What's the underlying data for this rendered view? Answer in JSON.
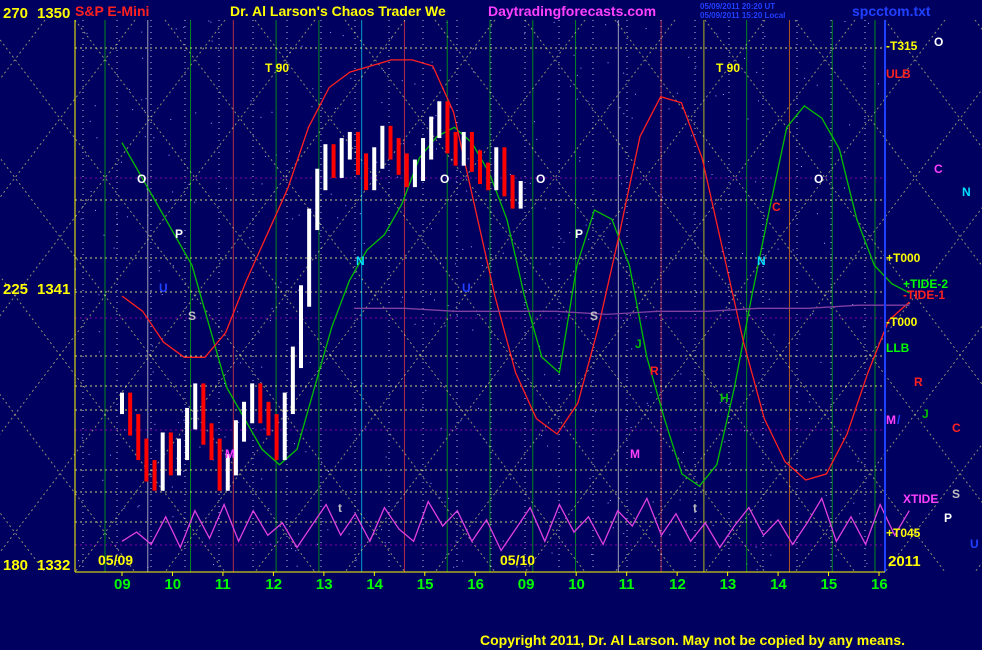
{
  "header": {
    "left_scale": "270",
    "price_top": "1350",
    "symbol": "S&P E-Mini",
    "title": "Dr. Al Larson's Chaos Trader We",
    "site": "Daytradingforecasts.com",
    "timestamp_ut": "05/09/2011 20:20 UT",
    "timestamp_local": "05/09/2011 15:20 Local",
    "file": "spcctom.txt"
  },
  "left_axis": {
    "mid_scale": "225",
    "price_mid": "1341",
    "bottom_scale": "180",
    "price_bottom": "1332"
  },
  "date_labels": [
    "05/09",
    "05/10"
  ],
  "year_label": "2011",
  "copyright": "Copyright 2011, Dr. Al Larson. May not be copied by any means.",
  "colors": {
    "background": "#000060",
    "price_up": "#ffffff",
    "price_down": "#ff0000",
    "grid_lines": "#ffff80",
    "green_line": "#00c000",
    "red_line": "#ff2020",
    "magenta_line": "#e040e0",
    "axis_text": "#ffff00",
    "title_text": "#ffff00",
    "site_text": "#ff40ff",
    "file_text": "#4060ff"
  },
  "chart_data": {
    "type": "line",
    "title": "S&P E-Mini",
    "x_ticks": [
      "09",
      "10",
      "11",
      "12",
      "13",
      "14",
      "15",
      "16",
      "09",
      "10",
      "11",
      "12",
      "13",
      "14",
      "15",
      "16"
    ],
    "y_ticks": [
      1350,
      1341,
      1332
    ],
    "ylim": [
      1332,
      1350
    ],
    "right_labels": [
      {
        "text": "-T315",
        "color": "#ffff00"
      },
      {
        "text": "ULB",
        "color": "#ff2020"
      },
      {
        "text": "+T000",
        "color": "#ffff00"
      },
      {
        "text": "+TIDE-2",
        "color": "#00ff00"
      },
      {
        "text": "-TIDE-1",
        "color": "#ff2020"
      },
      {
        "text": "-T000",
        "color": "#ffff00"
      },
      {
        "text": "LLB",
        "color": "#00ff00"
      },
      {
        "text": "M",
        "color": "#ff40ff"
      },
      {
        "text": "XTIDE",
        "color": "#ff40ff"
      },
      {
        "text": "+T045",
        "color": "#ffff00"
      }
    ],
    "planet_labels": [
      {
        "text": "O",
        "color": "#ffffff"
      },
      {
        "text": "C",
        "color": "#ff40ff"
      },
      {
        "text": "N",
        "color": "#00e0ff"
      },
      {
        "text": "C",
        "color": "#ff2020"
      },
      {
        "text": "R",
        "color": "#ff2020"
      },
      {
        "text": "J",
        "color": "#00c000"
      },
      {
        "text": "S",
        "color": "#c0c0c0"
      },
      {
        "text": "P",
        "color": "#ffffff"
      },
      {
        "text": "U",
        "color": "#2040ff"
      },
      {
        "text": "/",
        "color": "#2040ff"
      }
    ],
    "chart_markers": [
      {
        "text": "T  90",
        "color": "#ffff00"
      },
      {
        "text": "T  90",
        "color": "#ffff00"
      },
      {
        "text": "O",
        "color": "#ffffff"
      },
      {
        "text": "O",
        "color": "#ffffff"
      },
      {
        "text": "O",
        "color": "#ffffff"
      },
      {
        "text": "O",
        "color": "#ffffff"
      },
      {
        "text": "P",
        "color": "#ffffff"
      },
      {
        "text": "P",
        "color": "#ffffff"
      },
      {
        "text": "S",
        "color": "#c0c0c0"
      },
      {
        "text": "S",
        "color": "#c0c0c0"
      },
      {
        "text": "N",
        "color": "#00e0ff"
      },
      {
        "text": "N",
        "color": "#00e0ff"
      },
      {
        "text": "M",
        "color": "#ff40ff"
      },
      {
        "text": "M",
        "color": "#ff40ff"
      },
      {
        "text": "J",
        "color": "#00c000"
      },
      {
        "text": "H",
        "color": "#00c000"
      },
      {
        "text": "R",
        "color": "#ff2020"
      },
      {
        "text": "C",
        "color": "#ff2020"
      },
      {
        "text": "t",
        "color": "#c0c0c0"
      },
      {
        "text": "t",
        "color": "#c0c0c0"
      },
      {
        "text": "U",
        "color": "#2040ff"
      },
      {
        "text": "U",
        "color": "#2040ff"
      }
    ],
    "series": [
      {
        "type": "candles",
        "color_up": "#ffffff",
        "color_down": "#ff0000",
        "values": [
          1337.5,
          1336.8,
          1336.0,
          1335.3,
          1335.0,
          1336.2,
          1335.5,
          1336.0,
          1337.0,
          1337.8,
          1336.5,
          1336.0,
          1335.0,
          1335.5,
          1336.6,
          1337.2,
          1337.8,
          1337.2,
          1336.8,
          1336.0,
          1337.5,
          1339.0,
          1341.0,
          1343.5,
          1344.8,
          1345.6,
          1345.2,
          1345.8,
          1346.0,
          1345.3,
          1344.8,
          1345.5,
          1346.2,
          1345.8,
          1345.3,
          1344.9,
          1345.1,
          1345.8,
          1346.5,
          1347.0,
          1346.0,
          1345.6,
          1346.0,
          1345.4,
          1345.0,
          1344.8,
          1345.5,
          1344.6,
          1344.2,
          1344.4
        ],
        "x_range": [
          0,
          7.9
        ]
      },
      {
        "name": "green",
        "color": "#00c000",
        "values": [
          1346,
          1345,
          1344,
          1343,
          1342,
          1340,
          1338,
          1337,
          1336,
          1335.5,
          1336,
          1338,
          1340,
          1341.5,
          1342.5,
          1343,
          1344,
          1345.5,
          1346.2,
          1346.5,
          1346,
          1345,
          1343.5,
          1341,
          1339,
          1338.5,
          1342,
          1343.8,
          1343.5,
          1342,
          1339,
          1337,
          1335.2,
          1334.8,
          1335.5,
          1338,
          1341,
          1343.8,
          1346.5,
          1347.2,
          1346.8,
          1345.8,
          1343.5,
          1342,
          1341.4,
          1341.1
        ],
        "x_range": [
          0,
          15.6
        ]
      },
      {
        "name": "red",
        "color": "#ff2020",
        "values": [
          1341,
          1340.5,
          1339.5,
          1339,
          1339,
          1339.8,
          1341.5,
          1343,
          1344.5,
          1346.5,
          1347.8,
          1348.3,
          1348.5,
          1348.7,
          1348.7,
          1348.5,
          1347,
          1344,
          1341,
          1338.5,
          1337,
          1336.5,
          1337.5,
          1340,
          1343,
          1346.2,
          1347.5,
          1347.3,
          1345.5,
          1342.5,
          1339.5,
          1337,
          1335.6,
          1335,
          1335.2,
          1336.5,
          1338.5,
          1340.2,
          1340.8
        ],
        "x_range": [
          0,
          15.6
        ]
      },
      {
        "name": "magenta",
        "color": "#e040e0",
        "values": [
          1333.0,
          1333.3,
          1332.9,
          1333.8,
          1332.8,
          1334.0,
          1333.1,
          1334.2,
          1333.0,
          1334.0,
          1333.2,
          1333.6,
          1332.8,
          1333.5,
          1334.2,
          1333.2,
          1333.9,
          1333.0,
          1334.1,
          1333.4,
          1333.0,
          1334.3,
          1333.5,
          1334.0,
          1333.0,
          1333.7,
          1332.7,
          1333.4,
          1334.1,
          1333.0,
          1334.2,
          1333.3,
          1333.8,
          1332.9,
          1334.0,
          1333.5,
          1334.4,
          1333.2,
          1333.9,
          1333.0,
          1333.6,
          1332.8,
          1333.5,
          1334.1,
          1333.2,
          1333.7,
          1332.9,
          1333.6,
          1334.4,
          1333.0,
          1333.8,
          1332.9,
          1334.2,
          1333.2,
          1334.0
        ],
        "x_range": [
          0,
          15.6
        ]
      },
      {
        "name": "purple",
        "color": "#8040a0",
        "values": [
          1340.6,
          1340.6,
          1340.5,
          1340.5,
          1340.5,
          1340.4,
          1340.5,
          1340.5,
          1340.6,
          1340.6,
          1340.7,
          1340.7
        ],
        "x_range": [
          4.6,
          15.6
        ]
      }
    ]
  }
}
